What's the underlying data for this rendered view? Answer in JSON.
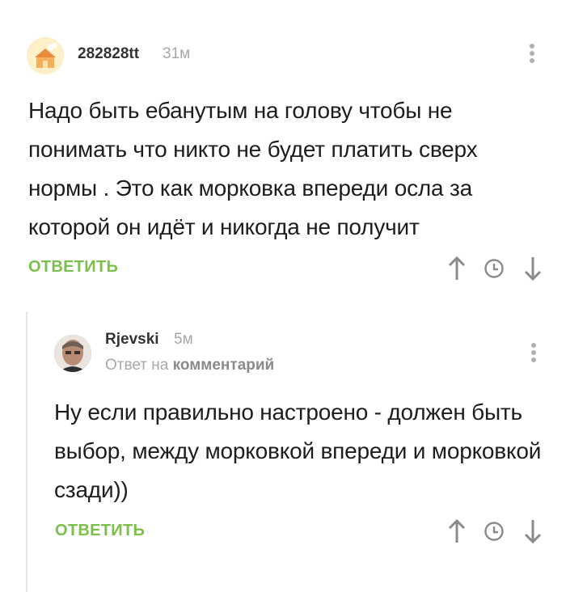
{
  "comments": [
    {
      "author": "282828tt",
      "time": "31м",
      "text": "Надо быть ебанутым на голову чтобы не понимать что никто не будет платить сверх нормы . Это как морковка впереди осла за которой он идёт и никогда не получит",
      "reply_label": "ОТВЕТИТЬ"
    },
    {
      "author": "Rjevski",
      "time": "5м",
      "reply_to_prefix": "Ответ на",
      "reply_to_target": "комментарий",
      "text": "Ну если правильно настроено - должен быть выбор, между морковкой впереди и морковкой сзади))",
      "reply_label": "ОТВЕТИТЬ"
    }
  ],
  "icons": [
    "avatar",
    "more-vertical-icon",
    "arrow-up-icon",
    "clock-icon",
    "arrow-down-icon"
  ],
  "colors": {
    "accent": "#7bc04c",
    "muted": "#a7a7a7",
    "icon": "#8a8a8a"
  }
}
